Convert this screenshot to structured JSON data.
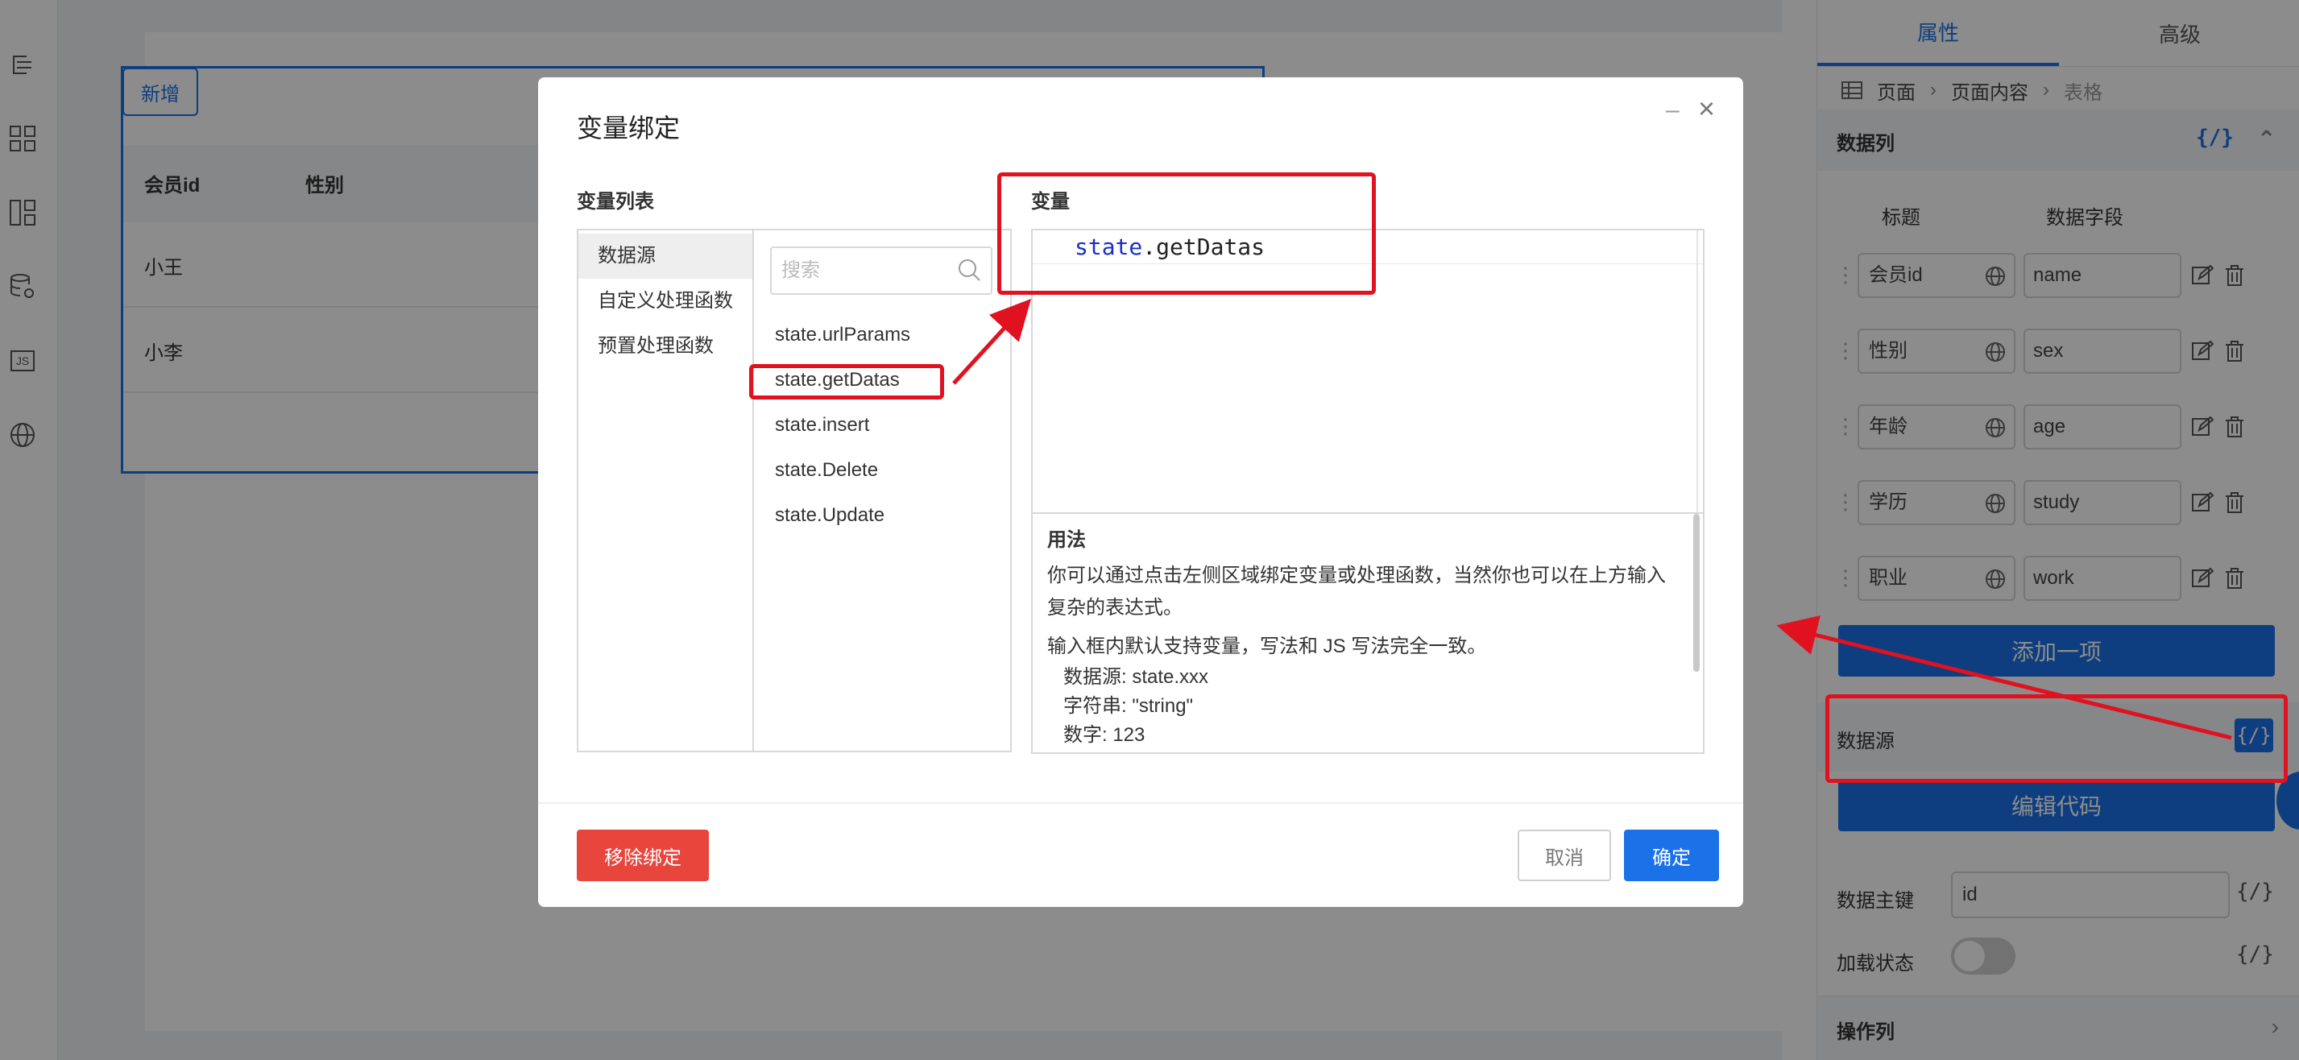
{
  "left_rail": {
    "icons": [
      "outline-icon",
      "components-icon",
      "layout-icon",
      "datasource-settings-icon",
      "js-icon",
      "globe-icon"
    ],
    "js_label": "JS"
  },
  "canvas": {
    "add_label": "新增",
    "columns": [
      "会员id",
      "性别"
    ],
    "rows": [
      [
        "小王"
      ],
      [
        "小李"
      ]
    ]
  },
  "right_panel": {
    "tabs": [
      "属性",
      "高级"
    ],
    "breadcrumb": [
      "页面",
      "页面内容",
      "表格"
    ],
    "columns_section": {
      "title": "数据列",
      "code_icon": "{/}",
      "col_headers": [
        "标题",
        "数据字段"
      ],
      "items": [
        {
          "title": "会员id",
          "key": "name"
        },
        {
          "title": "性别",
          "key": "sex"
        },
        {
          "title": "年龄",
          "key": "age"
        },
        {
          "title": "学历",
          "key": "study"
        },
        {
          "title": "职业",
          "key": "work"
        }
      ],
      "add_label": "添加一项"
    },
    "datasource": {
      "label": "数据源",
      "bind_label": "{/}"
    },
    "edit_code_label": "编辑代码",
    "primary_key": {
      "label": "数据主键",
      "value": "id",
      "code_icon": "{/}"
    },
    "loading": {
      "label": "加载状态",
      "on": false,
      "code_icon": "{/}"
    },
    "ops": {
      "label": "操作列",
      "chevron": "›"
    }
  },
  "modal": {
    "title": "变量绑定",
    "minimize": "–",
    "close": "×",
    "list_title": "变量列表",
    "var_title": "变量",
    "categories": [
      "数据源",
      "自定义处理函数",
      "预置处理函数"
    ],
    "active_category": 0,
    "search_placeholder": "搜索",
    "variables": [
      "state.urlParams",
      "state.getDatas",
      "state.insert",
      "state.Delete",
      "state.Update"
    ],
    "selected_variable": 1,
    "editor": {
      "prefix": "state",
      "suffix": ".getDatas"
    },
    "usage": {
      "title": "用法",
      "p1": "你可以通过点击左侧区域绑定变量或处理函数，当然你也可以在上方输入复杂的表达式。",
      "p2": "输入框内默认支持变量，写法和 JS 写法完全一致。",
      "examples": [
        "数据源: state.xxx",
        "字符串: \"string\"",
        "数字: 123"
      ]
    },
    "unbind_label": "移除绑定",
    "cancel_label": "取消",
    "ok_label": "确定"
  },
  "colors": {
    "accent": "#1b72e8",
    "annotation": "#e0121f",
    "danger": "#e8453c"
  }
}
